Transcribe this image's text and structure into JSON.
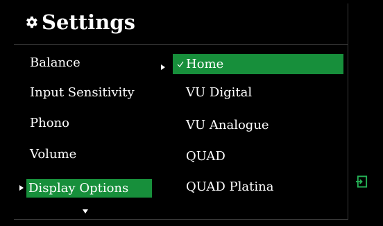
{
  "settings": {
    "title": "Settings",
    "gear_icon": "gear-icon",
    "left_menu": {
      "items": [
        {
          "label": "Balance"
        },
        {
          "label": "Input Sensitivity"
        },
        {
          "label": "Phono"
        },
        {
          "label": "Volume"
        },
        {
          "label": "Display Options",
          "selected": true
        }
      ]
    },
    "right_menu": {
      "items": [
        {
          "label": "Home",
          "selected": true,
          "checked": true
        },
        {
          "label": "VU Digital"
        },
        {
          "label": "VU Analogue"
        },
        {
          "label": "QUAD"
        },
        {
          "label": "QUAD Platina"
        }
      ]
    },
    "more_indicator": "chevron-down-icon",
    "exit_icon": "exit-icon"
  },
  "colors": {
    "background": "#000000",
    "accent": "#178f3b",
    "text": "#ffffff",
    "divider": "#3a3a3a"
  }
}
